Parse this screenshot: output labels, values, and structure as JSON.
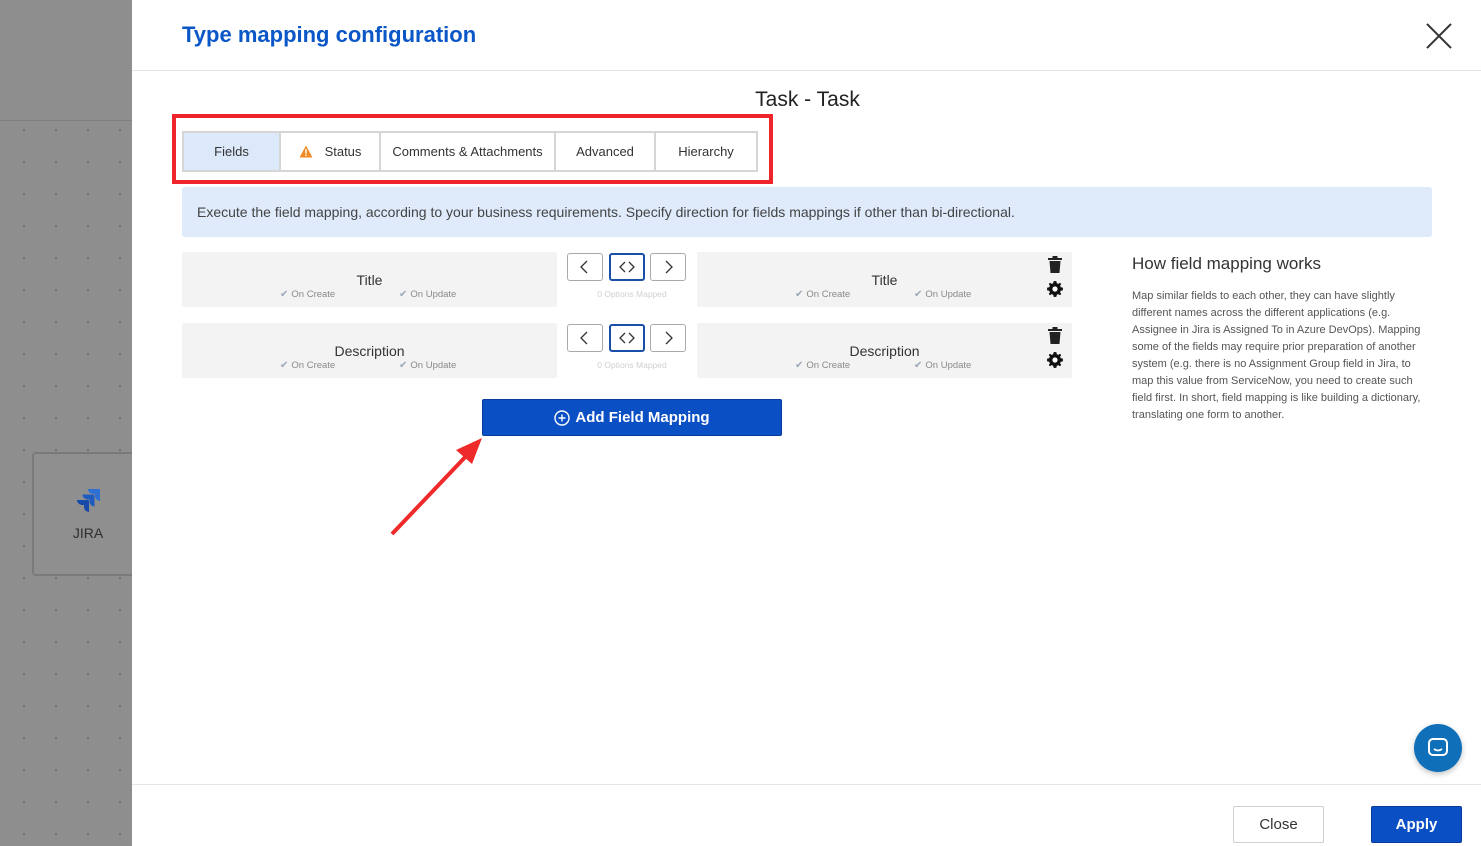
{
  "backdrop": {
    "jira_label": "JIRA"
  },
  "modal": {
    "title": "Type mapping configuration",
    "type_title": "Task - Task",
    "tabs": [
      {
        "label": "Fields",
        "active": true
      },
      {
        "label": "Status",
        "icon": "warning-icon"
      },
      {
        "label": "Comments & Attachments"
      },
      {
        "label": "Advanced"
      },
      {
        "label": "Hierarchy"
      }
    ],
    "info_banner": "Execute the field mapping, according to your business requirements. Specify direction for fields mappings if other than bi-directional.",
    "mappings": [
      {
        "left": {
          "name": "Title",
          "on_create": "On Create",
          "on_update": "On Update"
        },
        "right": {
          "name": "Title",
          "on_create": "On Create",
          "on_update": "On Update"
        },
        "options_mapped": "0 Options Mapped",
        "direction": "bi-directional"
      },
      {
        "left": {
          "name": "Description",
          "on_create": "On Create",
          "on_update": "On Update"
        },
        "right": {
          "name": "Description",
          "on_create": "On Create",
          "on_update": "On Update"
        },
        "options_mapped": "0 Options Mapped",
        "direction": "bi-directional"
      }
    ],
    "add_button": "Add Field Mapping",
    "help": {
      "title": "How field mapping works",
      "text": "Map similar fields to each other, they can have slightly different names across the different applications (e.g. Assignee in Jira is Assigned To in Azure DevOps). Mapping some of the fields may require prior preparation of another system (e.g. there is no Assignment Group field in Jira, to map this value from ServiceNow, you need to create such field first. In short, field mapping is like building a dictionary, translating one form to another."
    },
    "footer": {
      "close_label": "Close",
      "apply_label": "Apply"
    }
  },
  "colors": {
    "accent": "#0b4fc4",
    "title": "#0b57c7",
    "highlight": "#f0252b",
    "warning": "#f08a24"
  }
}
